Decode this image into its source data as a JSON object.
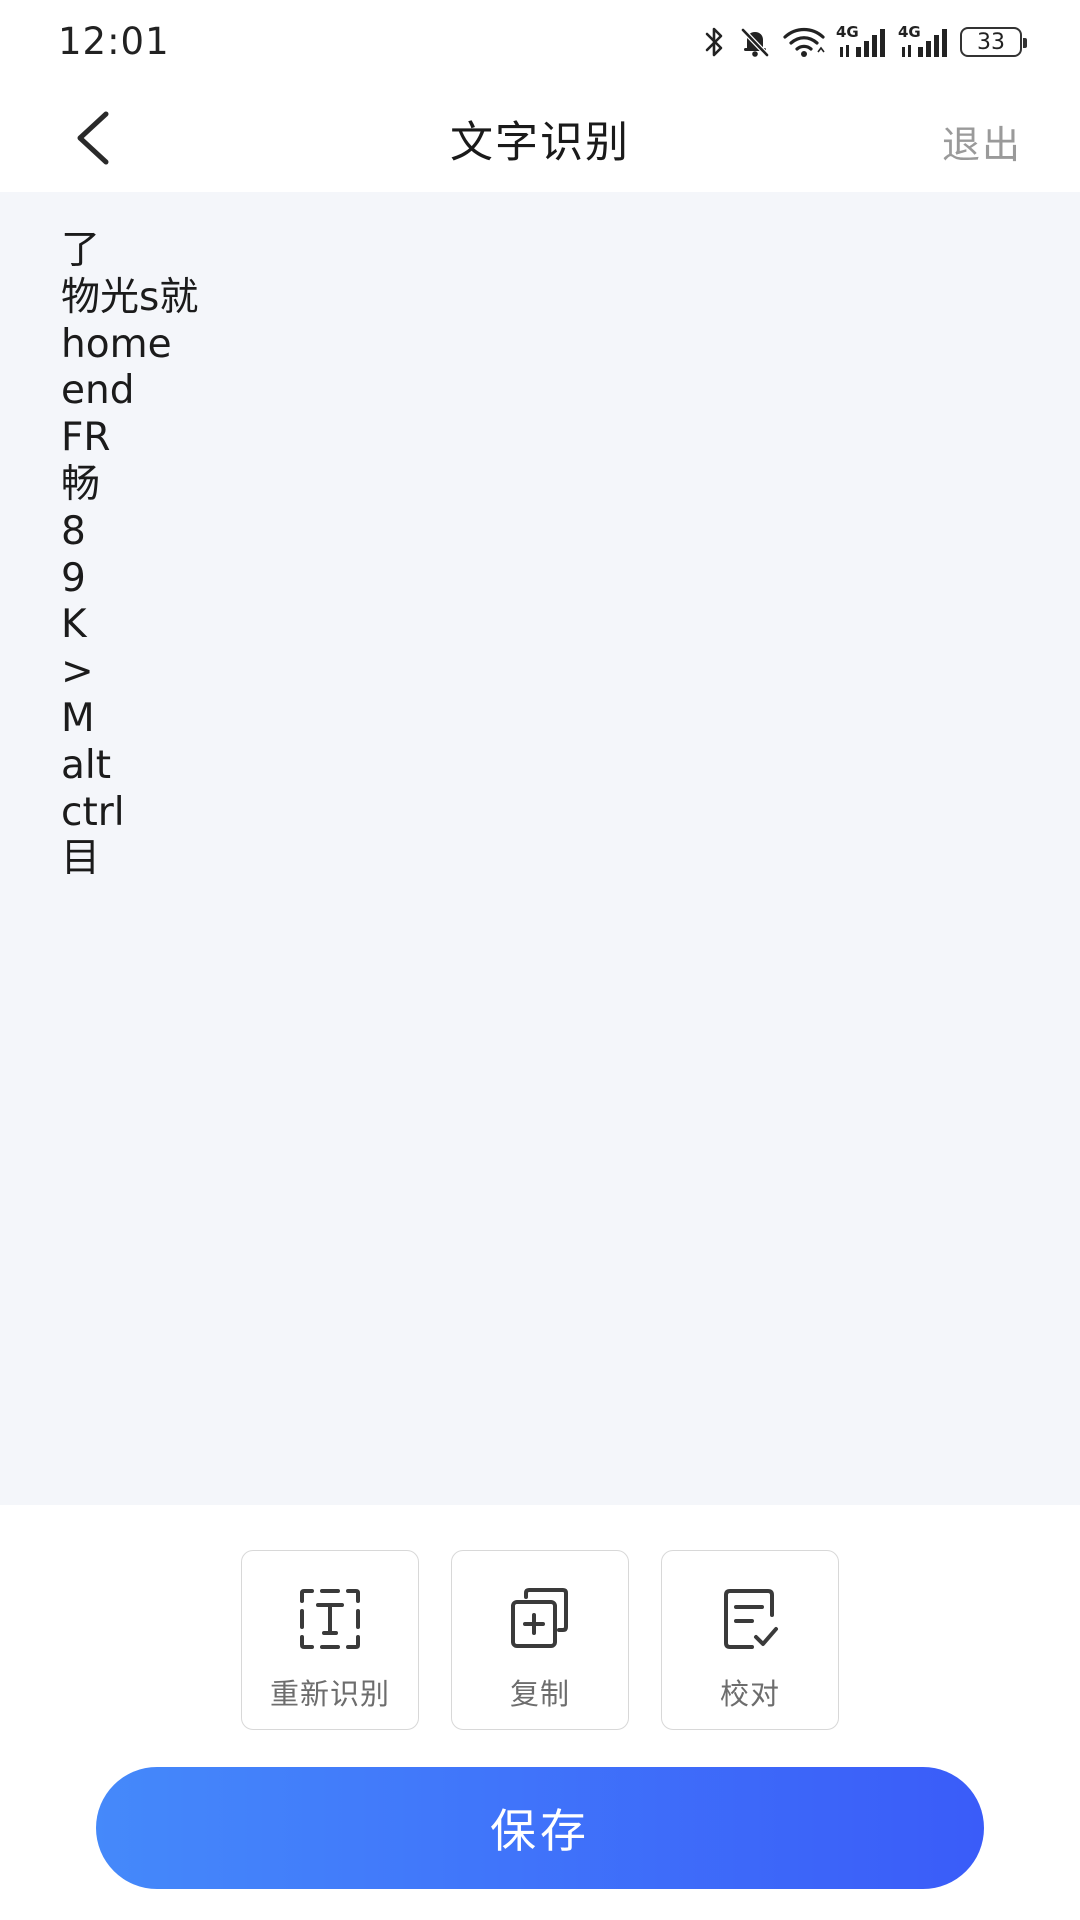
{
  "status_bar": {
    "time": "12:01",
    "battery": "33",
    "network_labels": [
      "4G",
      "4G"
    ]
  },
  "header": {
    "title": "文字识别",
    "exit_label": "退出"
  },
  "content": {
    "lines": [
      "了",
      "物光s就",
      "home",
      "end",
      "FR",
      "畅",
      "8",
      "9",
      "K",
      ">",
      "M",
      "alt",
      "ctrl",
      "目"
    ]
  },
  "toolbar": {
    "recognize_label": "重新识别",
    "copy_label": "复制",
    "proofread_label": "校对"
  },
  "save_label": "保存",
  "colors": {
    "accent_start": "#4589fa",
    "accent_end": "#3a5cf9",
    "content_bg": "#f4f6fa",
    "muted_text": "#9a9a9a"
  }
}
